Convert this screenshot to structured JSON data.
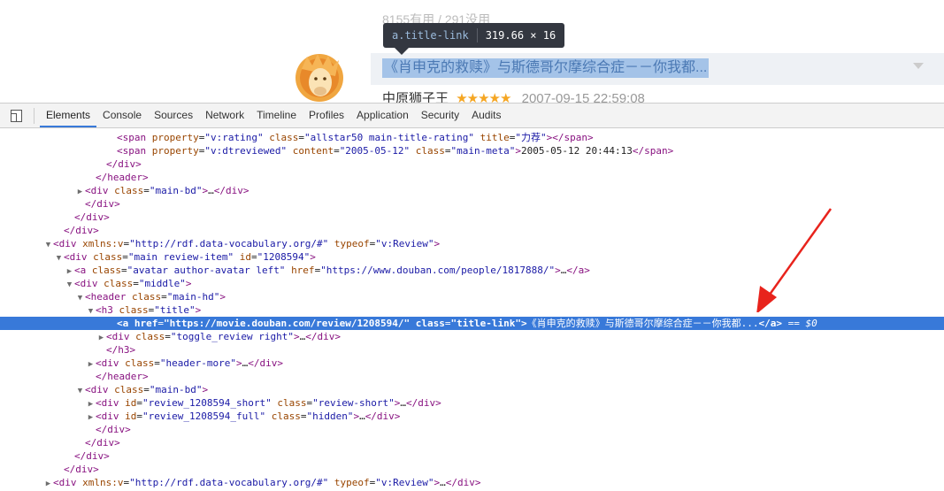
{
  "page": {
    "votes_text": "8155有用 / 291没用",
    "review_title": "《肖申克的救赎》与斯德哥尔摩综合症－－你我都...",
    "author": "中原狮子王",
    "stars": "★★★★★",
    "date": "2007-09-15 22:59:08"
  },
  "tooltip": {
    "selector": "a.title-link",
    "size": "319.66 × 16"
  },
  "devtools": {
    "tabs": [
      "Elements",
      "Console",
      "Sources",
      "Network",
      "Timeline",
      "Profiles",
      "Application",
      "Security",
      "Audits"
    ],
    "active_tab": "Elements",
    "dom_lines": [
      {
        "indent": 11,
        "tri": "",
        "html": "<span class=\"tn\">&lt;span</span> <span class=\"an\">property</span>=<span class=\"av\">\"v:rating\"</span> <span class=\"an\">class</span>=<span class=\"av\">\"allstar50 main-title-rating\"</span> <span class=\"an\">title</span>=<span class=\"av\">\"力荐\"</span><span class=\"tn\">&gt;&lt;/span&gt;</span>"
      },
      {
        "indent": 11,
        "tri": "",
        "html": "<span class=\"tn\">&lt;span</span> <span class=\"an\">property</span>=<span class=\"av\">\"v:dtreviewed\"</span> <span class=\"an\">content</span>=<span class=\"av\">\"2005-05-12\"</span> <span class=\"an\">class</span>=<span class=\"av\">\"main-meta\"</span><span class=\"tn\">&gt;</span><span class=\"tx\">2005-05-12 20:44:13</span><span class=\"tn\">&lt;/span&gt;</span>"
      },
      {
        "indent": 10,
        "tri": "",
        "html": "<span class=\"tn\">&lt;/div&gt;</span>"
      },
      {
        "indent": 9,
        "tri": "",
        "html": "<span class=\"tn\">&lt;/header&gt;</span>"
      },
      {
        "indent": 8,
        "tri": "▶",
        "html": "<span class=\"tn\">&lt;div</span> <span class=\"an\">class</span>=<span class=\"av\">\"main-bd\"</span><span class=\"tn\">&gt;</span>…<span class=\"tn\">&lt;/div&gt;</span>"
      },
      {
        "indent": 8,
        "tri": "",
        "html": "<span class=\"tn\">&lt;/div&gt;</span>"
      },
      {
        "indent": 7,
        "tri": "",
        "html": "<span class=\"tn\">&lt;/div&gt;</span>"
      },
      {
        "indent": 6,
        "tri": "",
        "html": "<span class=\"tn\">&lt;/div&gt;</span>"
      },
      {
        "indent": 5,
        "tri": "▼",
        "html": "<span class=\"tn\">&lt;div</span> <span class=\"an\">xmlns:v</span>=<span class=\"av\">\"http://rdf.data-vocabulary.org/#\"</span> <span class=\"an\">typeof</span>=<span class=\"av\">\"v:Review\"</span><span class=\"tn\">&gt;</span>"
      },
      {
        "indent": 6,
        "tri": "▼",
        "html": "<span class=\"tn\">&lt;div</span> <span class=\"an\">class</span>=<span class=\"av\">\"main review-item\"</span> <span class=\"an\">id</span>=<span class=\"av\">\"1208594\"</span><span class=\"tn\">&gt;</span>"
      },
      {
        "indent": 7,
        "tri": "▶",
        "html": "<span class=\"tn\">&lt;a</span> <span class=\"an\">class</span>=<span class=\"av\">\"avatar author-avatar left\"</span> <span class=\"an\">href</span>=<span class=\"av\">\"https://www.douban.com/people/1817888/\"</span><span class=\"tn\">&gt;</span>…<span class=\"tn\">&lt;/a&gt;</span>"
      },
      {
        "indent": 7,
        "tri": "▼",
        "html": "<span class=\"tn\">&lt;div</span> <span class=\"an\">class</span>=<span class=\"av\">\"middle\"</span><span class=\"tn\">&gt;</span>"
      },
      {
        "indent": 8,
        "tri": "▼",
        "html": "<span class=\"tn\">&lt;header</span> <span class=\"an\">class</span>=<span class=\"av\">\"main-hd\"</span><span class=\"tn\">&gt;</span>"
      },
      {
        "indent": 9,
        "tri": "▼",
        "html": "<span class=\"tn\">&lt;h3</span> <span class=\"an\">class</span>=<span class=\"av\">\"title\"</span><span class=\"tn\">&gt;</span>"
      },
      {
        "indent": 11,
        "tri": "",
        "selected": true,
        "html": "<span class=\"tn\">&lt;a</span> <span class=\"an\">href</span>=<span class=\"av\">\"https://movie.douban.com/review/1208594/\"</span> <span class=\"an\">class</span>=<span class=\"av\">\"title-link\"</span><span class=\"tn\">&gt;</span><span class=\"tx\">《肖申克的救赎》与斯德哥尔摩综合症－－你我都...</span><span class=\"tn\">&lt;/a&gt;</span> <span class=\"eq0\">== $0</span>"
      },
      {
        "indent": 10,
        "tri": "▶",
        "html": "<span class=\"tn\">&lt;div</span> <span class=\"an\">class</span>=<span class=\"av\">\"toggle_review right\"</span><span class=\"tn\">&gt;</span>…<span class=\"tn\">&lt;/div&gt;</span>"
      },
      {
        "indent": 10,
        "tri": "",
        "html": "<span class=\"tn\">&lt;/h3&gt;</span>"
      },
      {
        "indent": 9,
        "tri": "▶",
        "html": "<span class=\"tn\">&lt;div</span> <span class=\"an\">class</span>=<span class=\"av\">\"header-more\"</span><span class=\"tn\">&gt;</span>…<span class=\"tn\">&lt;/div&gt;</span>"
      },
      {
        "indent": 9,
        "tri": "",
        "html": "<span class=\"tn\">&lt;/header&gt;</span>"
      },
      {
        "indent": 8,
        "tri": "▼",
        "html": "<span class=\"tn\">&lt;div</span> <span class=\"an\">class</span>=<span class=\"av\">\"main-bd\"</span><span class=\"tn\">&gt;</span>"
      },
      {
        "indent": 9,
        "tri": "▶",
        "html": "<span class=\"tn\">&lt;div</span> <span class=\"an\">id</span>=<span class=\"av\">\"review_1208594_short\"</span> <span class=\"an\">class</span>=<span class=\"av\">\"review-short\"</span><span class=\"tn\">&gt;</span>…<span class=\"tn\">&lt;/div&gt;</span>"
      },
      {
        "indent": 9,
        "tri": "▶",
        "html": "<span class=\"tn\">&lt;div</span> <span class=\"an\">id</span>=<span class=\"av\">\"review_1208594_full\"</span> <span class=\"an\">class</span>=<span class=\"av\">\"hidden\"</span><span class=\"tn\">&gt;</span>…<span class=\"tn\">&lt;/div&gt;</span>"
      },
      {
        "indent": 9,
        "tri": "",
        "html": "<span class=\"tn\">&lt;/div&gt;</span>"
      },
      {
        "indent": 8,
        "tri": "",
        "html": "<span class=\"tn\">&lt;/div&gt;</span>"
      },
      {
        "indent": 7,
        "tri": "",
        "html": "<span class=\"tn\">&lt;/div&gt;</span>"
      },
      {
        "indent": 6,
        "tri": "",
        "html": "<span class=\"tn\">&lt;/div&gt;</span>"
      },
      {
        "indent": 5,
        "tri": "▶",
        "html": "<span class=\"tn\">&lt;div</span> <span class=\"an\">xmlns:v</span>=<span class=\"av\">\"http://rdf.data-vocabulary.org/#\"</span> <span class=\"an\">typeof</span>=<span class=\"av\">\"v:Review\"</span><span class=\"tn\">&gt;</span>…<span class=\"tn\">&lt;/div&gt;</span>"
      }
    ]
  },
  "colors": {
    "selection": "#3879d9",
    "arrow": "#e8231c",
    "tag": "#881280",
    "attr_name": "#994500",
    "attr_value": "#1a1aa6"
  }
}
